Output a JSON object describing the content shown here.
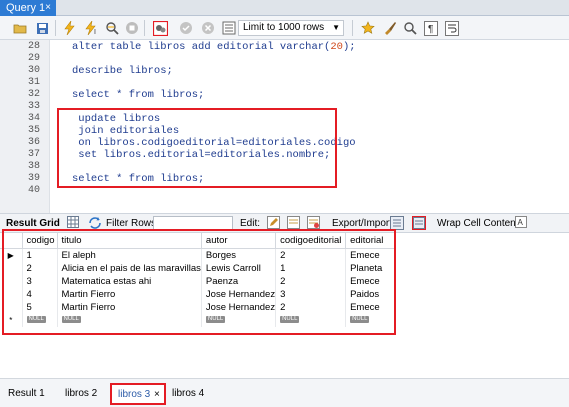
{
  "tab": {
    "title": "Query 1",
    "close": "×"
  },
  "toolbar": {
    "limit_value": "Limit to 1000 rows",
    "icons": [
      "folder-open",
      "save",
      "execute-lightning",
      "execute-current-lightning",
      "explain-magnifier",
      "stop",
      "toggle-autocommit",
      "commit-check",
      "rollback-x",
      "toggle-limit",
      "beautify-star",
      "format-brush",
      "find-magnifier",
      "invisible-chars",
      "wrap-lines"
    ]
  },
  "editor": {
    "lines": [
      {
        "n": "28",
        "text": "alter table libros add editorial varchar(",
        "num": "20",
        "tail": ");"
      },
      {
        "n": "29",
        "text": ""
      },
      {
        "n": "30",
        "text": "describe libros;"
      },
      {
        "n": "31",
        "text": ""
      },
      {
        "n": "32",
        "text": "select * from libros;"
      },
      {
        "n": "33",
        "text": ""
      },
      {
        "n": "34",
        "text": " update libros"
      },
      {
        "n": "35",
        "text": " join editoriales"
      },
      {
        "n": "36",
        "text": " on libros.codigoeditorial=editoriales.codigo"
      },
      {
        "n": "37",
        "text": " set libros.editorial=editoriales.nombre;"
      },
      {
        "n": "38",
        "text": ""
      },
      {
        "n": "39",
        "text": "select * from libros;"
      },
      {
        "n": "40",
        "text": ""
      }
    ]
  },
  "result_toolbar": {
    "grid_label": "Result Grid",
    "filter_label": "Filter Rows:",
    "edit_label": "Edit:",
    "export_label": "Export/Import:",
    "wrap_label": "Wrap Cell Content:"
  },
  "grid": {
    "columns": [
      "codigo",
      "titulo",
      "autor",
      "codigoeditorial",
      "editorial"
    ],
    "rows": [
      [
        "1",
        "El aleph",
        "Borges",
        "2",
        "Emece"
      ],
      [
        "2",
        "Alicia en el pais de las maravillas",
        "Lewis Carroll",
        "1",
        "Planeta"
      ],
      [
        "3",
        "Matematica estas ahi",
        "Paenza",
        "2",
        "Emece"
      ],
      [
        "4",
        "Martin Fierro",
        "Jose Hernandez",
        "3",
        "Paidos"
      ],
      [
        "5",
        "Martin Fierro",
        "Jose Hernandez",
        "2",
        "Emece"
      ]
    ],
    "null_label": "NULL",
    "new_row_marker": "*",
    "current_row_marker": "▶"
  },
  "bottom_tabs": {
    "result1": "Result 1",
    "libros2": "libros 2",
    "libros3": "libros 3",
    "libros3_close": "×",
    "libros4": "libros 4"
  }
}
